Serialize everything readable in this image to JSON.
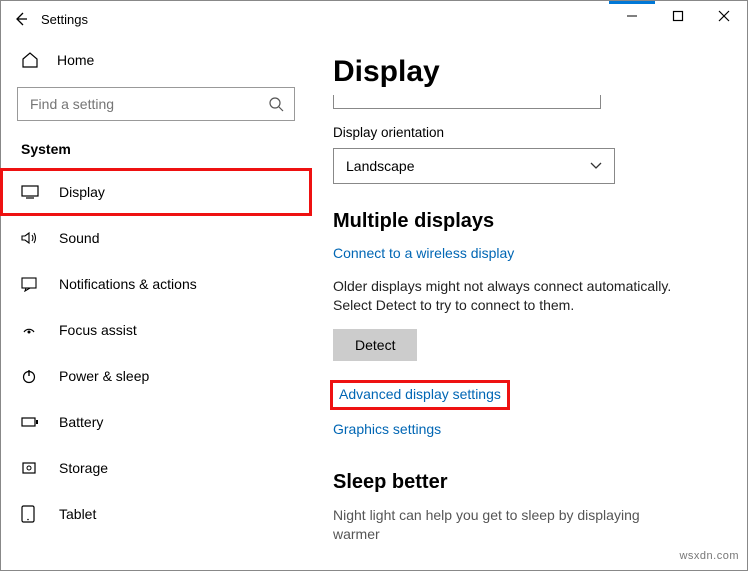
{
  "window": {
    "title": "Settings"
  },
  "sidebar": {
    "home": "Home",
    "search_placeholder": "Find a setting",
    "category": "System",
    "items": [
      {
        "label": "Display"
      },
      {
        "label": "Sound"
      },
      {
        "label": "Notifications & actions"
      },
      {
        "label": "Focus assist"
      },
      {
        "label": "Power & sleep"
      },
      {
        "label": "Battery"
      },
      {
        "label": "Storage"
      },
      {
        "label": "Tablet"
      }
    ]
  },
  "main": {
    "title": "Display",
    "orientation_label": "Display orientation",
    "orientation_value": "Landscape",
    "multi_heading": "Multiple displays",
    "connect_link": "Connect to a wireless display",
    "older_text": "Older displays might not always connect automatically. Select Detect to try to connect to them.",
    "detect_btn": "Detect",
    "advanced_link": "Advanced display settings",
    "graphics_link": "Graphics settings",
    "sleep_heading": "Sleep better",
    "sleep_text": "Night light can help you get to sleep by displaying warmer"
  },
  "watermark": "wsxdn.com"
}
